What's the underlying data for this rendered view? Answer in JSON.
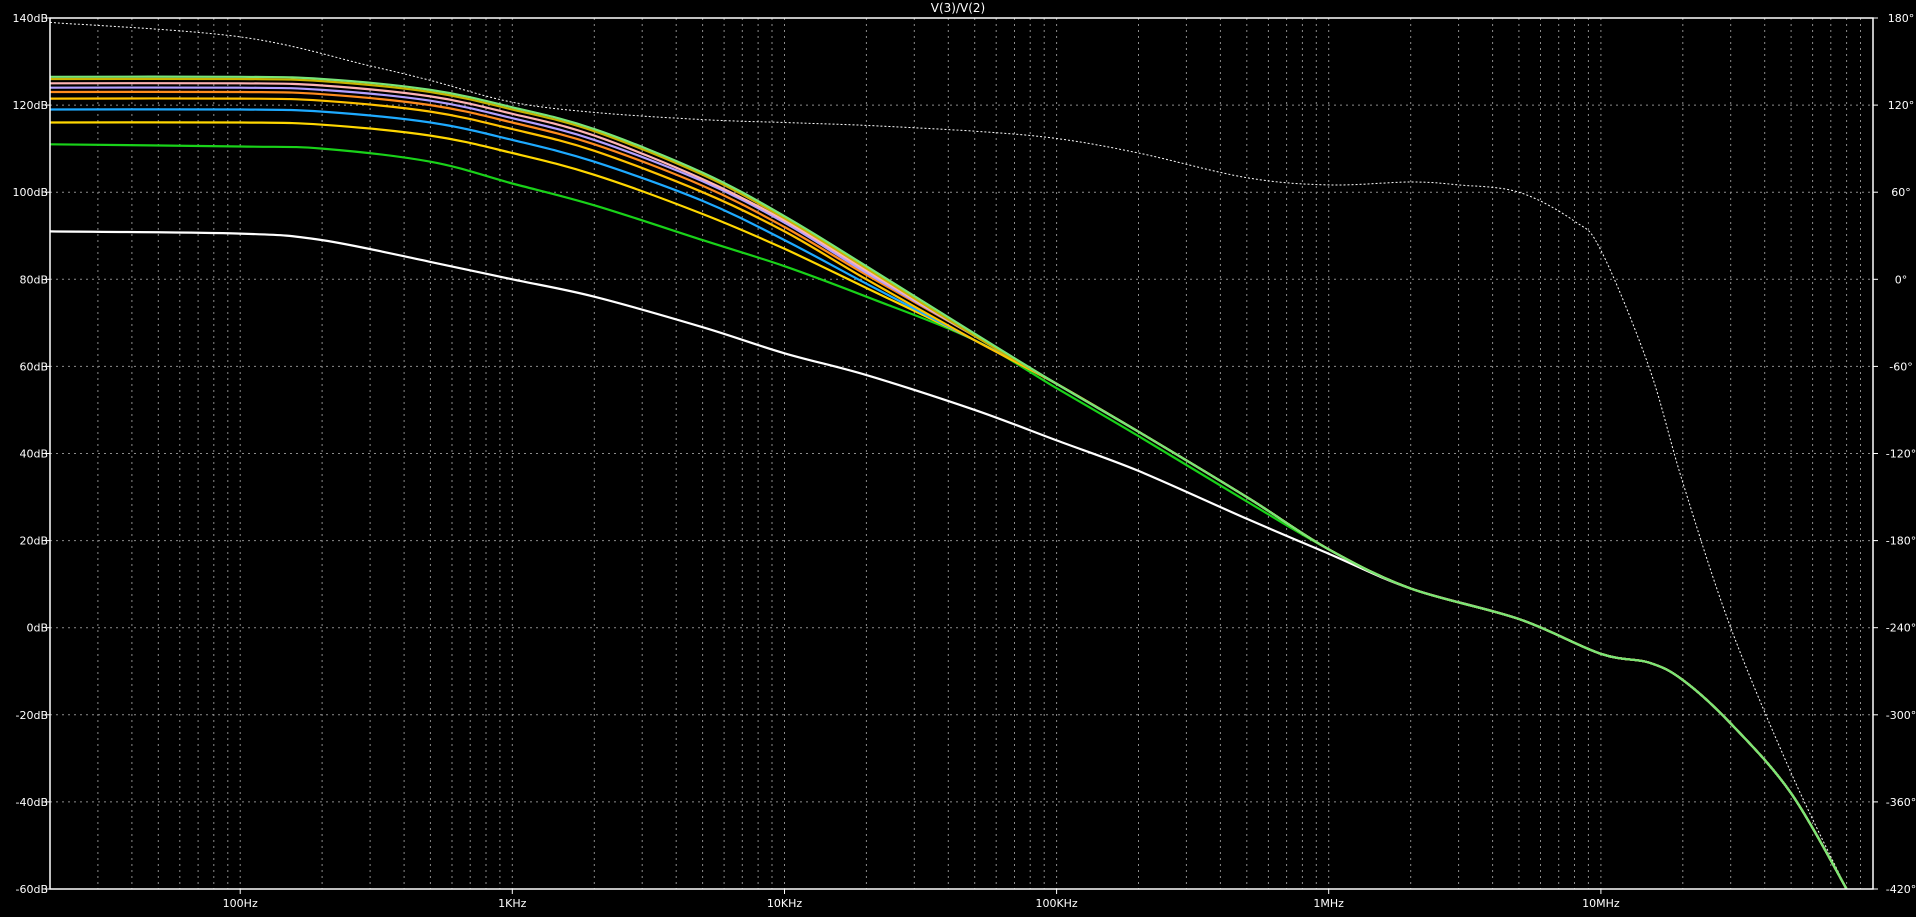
{
  "chart_data": {
    "type": "line",
    "title": "V(3)/V(2)",
    "x_scale": "log",
    "xlim": [
      20,
      100000000
    ],
    "ylim": [
      -60,
      140
    ],
    "y2lim": [
      -420,
      180
    ],
    "x_ticks": [
      {
        "value": 100,
        "label": "100Hz"
      },
      {
        "value": 1000,
        "label": "1KHz"
      },
      {
        "value": 10000,
        "label": "10KHz"
      },
      {
        "value": 100000,
        "label": "100KHz"
      },
      {
        "value": 1000000,
        "label": "1MHz"
      },
      {
        "value": 10000000,
        "label": "10MHz"
      }
    ],
    "y_ticks": [
      {
        "value": 140,
        "label": "140dB"
      },
      {
        "value": 120,
        "label": "120dB"
      },
      {
        "value": 100,
        "label": "100dB"
      },
      {
        "value": 80,
        "label": "80dB"
      },
      {
        "value": 60,
        "label": "60dB"
      },
      {
        "value": 40,
        "label": "40dB"
      },
      {
        "value": 20,
        "label": "20dB"
      },
      {
        "value": 0,
        "label": "0dB"
      },
      {
        "value": -20,
        "label": "-20dB"
      },
      {
        "value": -40,
        "label": "-40dB"
      },
      {
        "value": -60,
        "label": "-60dB"
      }
    ],
    "y2_ticks": [
      {
        "value": 180,
        "label": "180°"
      },
      {
        "value": 120,
        "label": "120°"
      },
      {
        "value": 60,
        "label": "60°"
      },
      {
        "value": 0,
        "label": "0°"
      },
      {
        "value": -60,
        "label": "-60°"
      },
      {
        "value": -120,
        "label": "-120°"
      },
      {
        "value": -180,
        "label": "-180°"
      },
      {
        "value": -240,
        "label": "-240°"
      },
      {
        "value": -300,
        "label": "-300°"
      },
      {
        "value": -360,
        "label": "-360°"
      },
      {
        "value": -420,
        "label": "-420°"
      }
    ],
    "grid": true,
    "colors": {
      "background": "#000000",
      "grid": "#8c8c8c",
      "axis": "#ffffff",
      "text": "#ffffff"
    },
    "series": [
      {
        "color": "#ffffff",
        "x": [
          20,
          100,
          200,
          500,
          1000,
          2000,
          5000,
          10000,
          20000,
          50000,
          100000,
          200000,
          500000,
          1000000,
          2000000,
          5000000,
          10000000,
          15000000,
          20000000,
          30000000,
          50000000,
          80000000
        ],
        "y": [
          91,
          90.5,
          89,
          84,
          80,
          76,
          69,
          63,
          58,
          50,
          43,
          36,
          25,
          17,
          9,
          2,
          -6,
          -8,
          -12,
          -22,
          -38,
          -60
        ]
      },
      {
        "color": "#19d219",
        "x": [
          20,
          100,
          200,
          500,
          1000,
          2000,
          5000,
          10000,
          20000,
          50000,
          100000,
          200000,
          500000,
          1000000,
          2000000,
          5000000,
          10000000,
          15000000,
          20000000,
          30000000,
          50000000,
          80000000
        ],
        "y": [
          111,
          110.5,
          110,
          107,
          102,
          97,
          89,
          83,
          76,
          66,
          55,
          44,
          29,
          18,
          9,
          2,
          -6,
          -8,
          -12,
          -22,
          -38,
          -60
        ]
      },
      {
        "color": "#ffd700",
        "x": [
          20,
          100,
          200,
          500,
          1000,
          2000,
          5000,
          10000,
          20000,
          50000,
          100000,
          200000,
          500000,
          1000000,
          2000000,
          5000000,
          10000000,
          15000000,
          20000000,
          30000000,
          50000000,
          80000000
        ],
        "y": [
          116,
          116,
          115.5,
          113,
          109,
          104,
          95,
          87,
          78,
          66,
          56,
          45,
          30,
          18,
          9,
          2,
          -6,
          -8,
          -12,
          -22,
          -38,
          -60
        ]
      },
      {
        "color": "#1eaaff",
        "x": [
          20,
          100,
          200,
          500,
          1000,
          2000,
          5000,
          10000,
          20000,
          50000,
          100000,
          200000,
          500000,
          1000000,
          2000000,
          5000000,
          10000000,
          15000000,
          20000000,
          30000000,
          50000000,
          80000000
        ],
        "y": [
          119,
          119,
          118.5,
          116,
          112,
          107,
          98,
          89,
          79,
          66,
          56,
          45,
          30,
          18,
          9,
          2,
          -6,
          -8,
          -12,
          -22,
          -38,
          -60
        ]
      },
      {
        "color": "#ffc300",
        "x": [
          20,
          100,
          200,
          500,
          1000,
          2000,
          5000,
          10000,
          20000,
          50000,
          100000,
          200000,
          500000,
          1000000,
          2000000,
          5000000,
          10000000,
          15000000,
          20000000,
          30000000,
          50000000,
          80000000
        ],
        "y": [
          121.5,
          121.5,
          121,
          118.5,
          114.5,
          109.5,
          100,
          91,
          80,
          66,
          56,
          45,
          30,
          18,
          9,
          2,
          -6,
          -8,
          -12,
          -22,
          -38,
          -60
        ]
      },
      {
        "color": "#ff8c1e",
        "x": [
          20,
          100,
          200,
          500,
          1000,
          2000,
          5000,
          10000,
          20000,
          50000,
          100000,
          200000,
          500000,
          1000000,
          2000000,
          5000000,
          10000000,
          15000000,
          20000000,
          30000000,
          50000000,
          80000000
        ],
        "y": [
          123,
          123,
          122.5,
          120,
          116,
          111,
          101.5,
          92,
          81,
          67,
          56,
          45,
          30,
          18,
          9,
          2,
          -6,
          -8,
          -12,
          -22,
          -38,
          -60
        ]
      },
      {
        "color": "#b4a0ff",
        "x": [
          20,
          100,
          200,
          500,
          1000,
          2000,
          5000,
          10000,
          20000,
          50000,
          100000,
          200000,
          500000,
          1000000,
          2000000,
          5000000,
          10000000,
          15000000,
          20000000,
          30000000,
          50000000,
          80000000
        ],
        "y": [
          124,
          124,
          123.5,
          121,
          117,
          112,
          102.5,
          93,
          81.5,
          67,
          56,
          45,
          30,
          18,
          9,
          2,
          -6,
          -8,
          -12,
          -22,
          -38,
          -60
        ]
      },
      {
        "color": "#ffb4b4",
        "x": [
          20,
          100,
          200,
          500,
          1000,
          2000,
          5000,
          10000,
          20000,
          50000,
          100000,
          200000,
          500000,
          1000000,
          2000000,
          5000000,
          10000000,
          15000000,
          20000000,
          30000000,
          50000000,
          80000000
        ],
        "y": [
          125,
          125,
          124.5,
          122,
          118,
          113,
          103,
          93.5,
          82,
          67,
          56,
          45,
          30,
          18,
          9,
          2,
          -6,
          -8,
          -12,
          -22,
          -38,
          -60
        ]
      },
      {
        "color": "#c8b400",
        "x": [
          20,
          100,
          200,
          500,
          1000,
          2000,
          5000,
          10000,
          20000,
          50000,
          100000,
          200000,
          500000,
          1000000,
          2000000,
          5000000,
          10000000,
          15000000,
          20000000,
          30000000,
          50000000,
          80000000
        ],
        "y": [
          126,
          126,
          125.5,
          123,
          119,
          114,
          104,
          94,
          82.5,
          67,
          56,
          45,
          30,
          18,
          9,
          2,
          -6,
          -8,
          -12,
          -22,
          -38,
          -60
        ]
      },
      {
        "color": "#78e678",
        "x": [
          20,
          100,
          200,
          500,
          1000,
          2000,
          5000,
          10000,
          20000,
          50000,
          100000,
          200000,
          500000,
          1000000,
          2000000,
          5000000,
          10000000,
          15000000,
          20000000,
          30000000,
          50000000,
          80000000
        ],
        "y": [
          126.5,
          126.5,
          126,
          123.5,
          119.5,
          114.5,
          104.5,
          94.5,
          83,
          67.5,
          56,
          45,
          30,
          18,
          9,
          2,
          -6,
          -8,
          -12,
          -22,
          -38,
          -60
        ]
      },
      {
        "color": "#ffffff",
        "dashed": true,
        "axis": "right",
        "x": [
          20,
          100,
          300,
          500,
          1000,
          2000,
          5000,
          10000,
          20000,
          50000,
          100000,
          200000,
          500000,
          1000000,
          2000000,
          3000000,
          5000000,
          8000000,
          10000000,
          15000000,
          20000000,
          30000000,
          50000000,
          80000000
        ],
        "y": [
          177,
          167,
          147,
          137,
          122,
          115,
          110,
          108,
          106,
          102,
          97,
          87,
          70,
          65,
          67,
          65,
          60,
          40,
          20,
          -60,
          -140,
          -240,
          -340,
          -420
        ]
      }
    ]
  }
}
